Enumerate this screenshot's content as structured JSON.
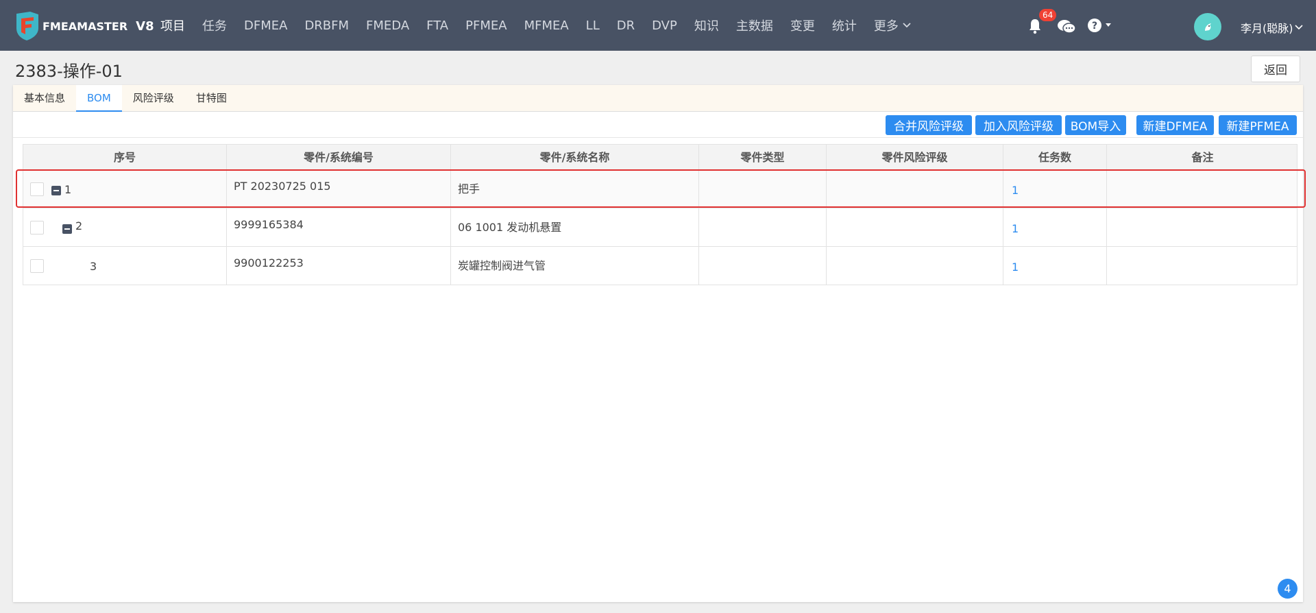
{
  "nav": {
    "logo_text": "FMEAMASTER",
    "version": "V8",
    "items": [
      "项目",
      "任务",
      "DFMEA",
      "DRBFM",
      "FMEDA",
      "FTA",
      "PFMEA",
      "MFMEA",
      "LL",
      "DR",
      "DVP",
      "知识",
      "主数据",
      "变更",
      "统计"
    ],
    "more_label": "更多",
    "active_index": 0,
    "notification_count": "64",
    "user_name": "李月(聪脉)"
  },
  "page": {
    "title": "2383-操作-01",
    "back_label": "返回"
  },
  "tabs": {
    "items": [
      "基本信息",
      "BOM",
      "风险评级",
      "甘特图"
    ],
    "active_index": 1
  },
  "toolbar": {
    "buttons": [
      "合并风险评级",
      "加入风险评级",
      "BOM导入",
      "新建DFMEA",
      "新建PFMEA"
    ]
  },
  "table": {
    "columns": [
      "序号",
      "零件/系统编号",
      "零件/系统名称",
      "零件类型",
      "零件风险评级",
      "任务数",
      "备注"
    ],
    "rows": [
      {
        "seq": "1",
        "part_no": "PT 20230725 015",
        "part_name": "把手",
        "part_type": "",
        "risk_level": "",
        "task_count": "1",
        "remark": ""
      },
      {
        "seq": "2",
        "part_no": "9999165384",
        "part_name": "06 1001 发动机悬置",
        "part_type": "",
        "risk_level": "",
        "task_count": "1",
        "remark": ""
      },
      {
        "seq": "3",
        "part_no": "9900122253",
        "part_name": "炭罐控制阀进气管",
        "part_type": "",
        "risk_level": "",
        "task_count": "1",
        "remark": ""
      }
    ]
  },
  "footer": {
    "corner_badge": "4"
  },
  "colors": {
    "nav_bg": "#485264",
    "primary": "#2d8cf0",
    "badge_red": "#f04134",
    "highlight": "#e03030"
  }
}
